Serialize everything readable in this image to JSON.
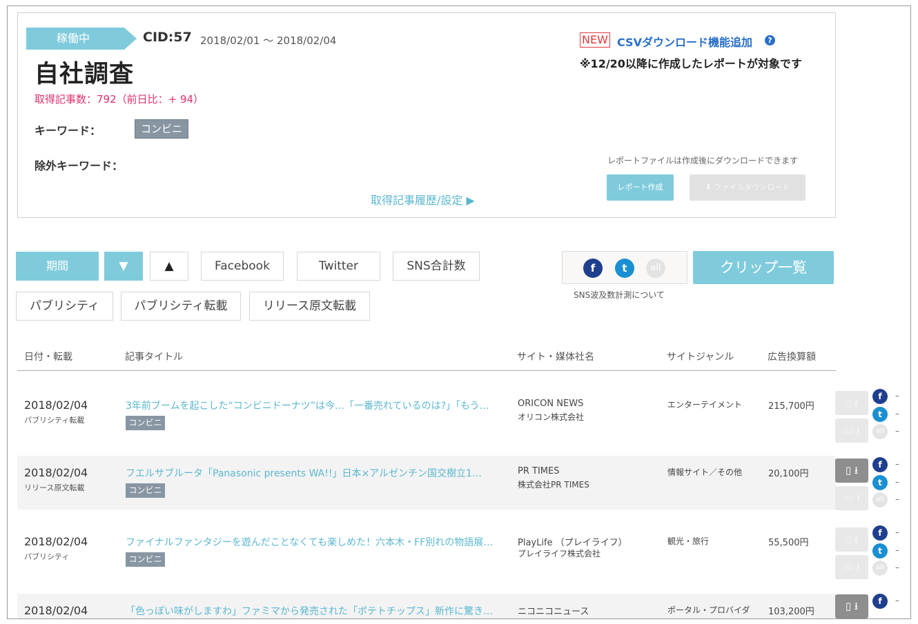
{
  "header": {
    "status": "稼働中",
    "cid": "CID:57",
    "period": "2018/02/01 ～ 2018/02/04",
    "title": "自社調査",
    "article_count": "取得記事数：792（前日比：+ 94）",
    "keyword_label": "キーワード：",
    "keyword_tag": "コンビニ",
    "exclude_label": "除外キーワード：",
    "history_link": "取得記事履歴/設定 ▶",
    "new_badge": "NEW",
    "csv_feature": "CSVダウンロード機能追加",
    "help_glyph": "?",
    "csv_note": "※12/20以降に作成したレポートが対象です",
    "download_note": "レポートファイルは作成後にダウンロードできます",
    "report_button": "レポート作成",
    "download_button": "⬇ ファイルダウンロード"
  },
  "filters": {
    "period": "期間",
    "sort_desc": "▼",
    "sort_asc": "▲",
    "facebook": "Facebook",
    "twitter": "Twitter",
    "sns_total": "SNS合計数",
    "publicity": "パブリシティ",
    "publicity_repost": "パブリシティ転載",
    "release_repost": "リリース原文転載",
    "sns_icons": {
      "facebook": "f",
      "twitter": "t",
      "all": "all"
    },
    "sns_help": "SNS波及数計測について",
    "clip_list": "クリップ一覧"
  },
  "icons": {
    "status_tag": "status-arrow-tag",
    "help": "help-icon",
    "facebook": "facebook-icon",
    "twitter": "twitter-icon",
    "all": "all-sns-icon",
    "controls": [
      "mobile-icon",
      "download-icon",
      "clip-icon"
    ]
  },
  "colors": {
    "accent": "#7fcbdc",
    "link": "#5ab7cf",
    "count": "#e0306a",
    "new": "#e23b3b",
    "csv": "#2a6fc9",
    "tag": "#8896a3",
    "facebook": "#1f3f8e",
    "twitter": "#1a8fd1"
  },
  "table": {
    "columns": [
      "日付・転載",
      "記事タイトル",
      "サイト・媒体社名",
      "サイトジャンル",
      "広告換算額"
    ],
    "rows": [
      {
        "date": "2018/02/04",
        "type": "パブリシティ転載",
        "title": "3年前ブームを起こした“コンビニドーナツ”は今…「一番売れているのは?」「もう…",
        "tag": "コンビニ",
        "site": "ORICON NEWS",
        "company": "オリコン株式会社",
        "genre": "エンターテイメント",
        "price": "215,700円",
        "ctrl_active": false,
        "dashes": [
          "–",
          "–",
          "–"
        ]
      },
      {
        "date": "2018/02/04",
        "type": "リリース原文転載",
        "title": "フエルサブルータ「Panasonic presents WA!!」日本×アルゼンチン国交樹立1…",
        "tag": "コンビニ",
        "site": "PR TIMES",
        "company": "株式会社PR TIMES",
        "genre": "情報サイト／その他",
        "price": "20,100円",
        "ctrl_active": true,
        "dashes": [
          "–",
          "–",
          "–"
        ]
      },
      {
        "date": "2018/02/04",
        "type": "パブリシティ",
        "title": "ファイナルファンタジーを遊んだことなくても楽しめた！六本木・FF別れの物語展…",
        "tag": "コンビニ",
        "site": "PlayLife （プレイライフ）",
        "company": "プレイライフ株式会社",
        "genre": "観光・旅行",
        "price": "55,500円",
        "ctrl_active": false,
        "dashes": [
          "–",
          "–",
          "–"
        ]
      },
      {
        "date": "2018/02/04",
        "type": "",
        "title": "「色っぽい味がしますわ」ファミマから発売された「ポテトチップス」新作に驚き…",
        "tag": "",
        "site": "ニコニコニュース",
        "company": "",
        "genre": "ポータル・プロバイダ",
        "price": "103,200円",
        "ctrl_active": true,
        "dashes": [
          "–"
        ]
      }
    ]
  }
}
